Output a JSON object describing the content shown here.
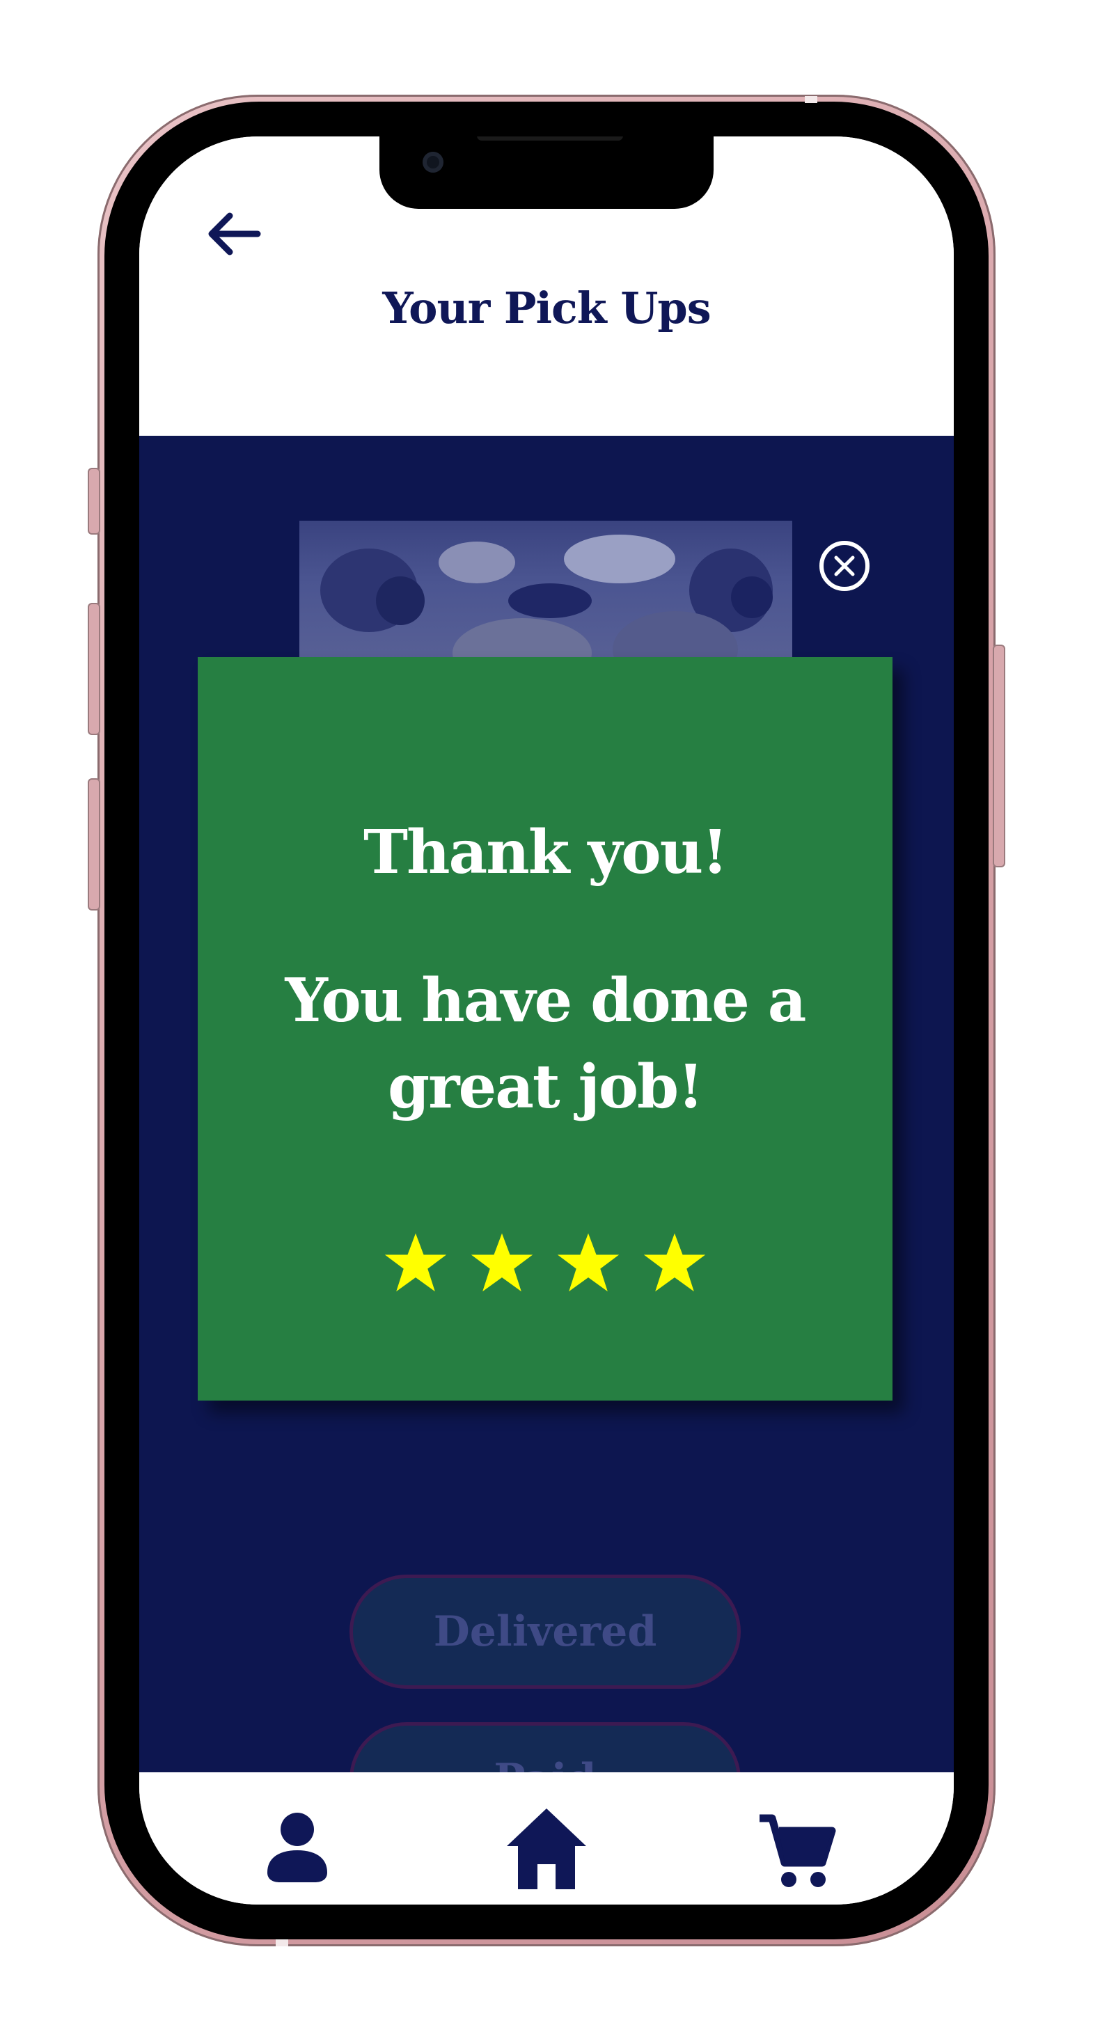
{
  "header": {
    "title": "Your Pick Ups",
    "back_icon": "arrow-left-icon"
  },
  "product": {
    "image_icon": "blueberry-pastry-image",
    "close_icon": "close-circle-icon"
  },
  "modal": {
    "title": "Thank you!",
    "message": "You have done a great job!",
    "rating": 4,
    "rating_max": 4,
    "background_color": "#267f42",
    "star_color": "#ffff00"
  },
  "status_buttons": {
    "delivered_label": "Delivered",
    "paid_label": "Paid"
  },
  "bottom_nav": {
    "items": [
      {
        "icon": "person-icon"
      },
      {
        "icon": "home-icon"
      },
      {
        "icon": "cart-icon"
      }
    ]
  },
  "theme": {
    "primary": "#0d1650",
    "accent": "#0f1757"
  }
}
